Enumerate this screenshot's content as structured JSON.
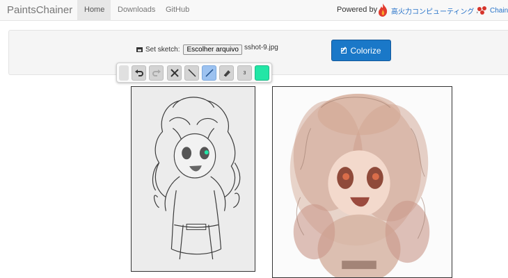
{
  "navbar": {
    "brand": "PaintsChainer",
    "links": [
      "Home",
      "Downloads",
      "GitHub"
    ],
    "powered_by": "Powered by",
    "sponsor1": "高火力コンピューティング",
    "separator": ",",
    "sponsor2": "Chainer"
  },
  "sketch": {
    "label": "Set sketch:",
    "file_button": "Escolher arquivo",
    "file_name": "sshot-9.jpg"
  },
  "colorize_button": "Colorize",
  "toolbar": {
    "tools": [
      "undo-icon",
      "redo-icon",
      "clear-icon",
      "line-icon",
      "pen-icon",
      "eraser-icon"
    ],
    "active_tool": "pen",
    "brush_size": "3",
    "current_color": "#22e6a6"
  },
  "colors": {
    "accent": "#1a78c8",
    "nav_bg": "#f8f8f8",
    "panel_bg": "#f5f5f5"
  }
}
